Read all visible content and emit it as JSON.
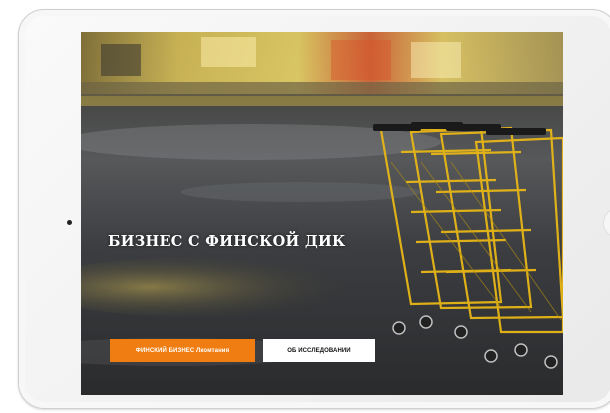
{
  "hero": {
    "title": "БИЗНЕС С ФИНСКОЙ ДИК"
  },
  "buttons": {
    "primary_label": "ФИНСКИЙ БИЗНЕС Лкомтания",
    "secondary_label": "ОБ ИССЛЕДОВАНИИ"
  },
  "colors": {
    "accent_orange": "#f07d12",
    "secondary_button_bg": "#ffffff",
    "cart_yellow": "#e8b717"
  }
}
